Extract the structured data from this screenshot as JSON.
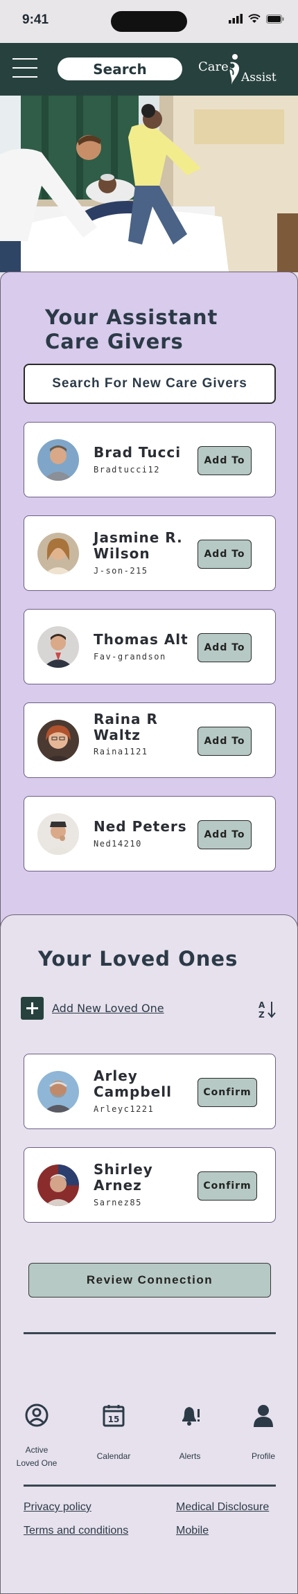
{
  "status_bar": {
    "time": "9:41"
  },
  "header": {
    "search_label": "Search",
    "logo_care": "Care",
    "logo_assist": "Assist"
  },
  "assistants": {
    "title_line1": "Your Assistant",
    "title_line2": "Care Givers",
    "search_new_label": "Search For New Care Givers",
    "cards": [
      {
        "name": "Brad Tucci",
        "username": "Bradtucci12",
        "button": "Add To"
      },
      {
        "name": "Jasmine R. Wilson",
        "username": "J-son-215",
        "button": "Add To"
      },
      {
        "name": "Thomas Alt",
        "username": "Fav-grandson",
        "button": "Add To"
      },
      {
        "name": "Raina R Waltz",
        "username": "Raina1121",
        "button": "Add To"
      },
      {
        "name": "Ned Peters",
        "username": "Ned14210",
        "button": "Add To"
      }
    ]
  },
  "loved_ones": {
    "title": "Your Loved Ones",
    "add_label": "Add New Loved One",
    "cards": [
      {
        "name": "Arley Campbell",
        "username": "Arleyc1221",
        "button": "Confirm"
      },
      {
        "name": "Shirley Arnez",
        "username": "Sarnez85",
        "button": "Confirm"
      }
    ],
    "review_label": "Review Connection"
  },
  "nav": {
    "active_line1": "Active",
    "active_line2": "Loved One",
    "calendar": "Calendar",
    "calendar_day": "15",
    "alerts": "Alerts",
    "profile": "Profile"
  },
  "footer": {
    "privacy": "Privacy policy",
    "medical": "Medical Disclosure",
    "terms": "Terms and conditions",
    "mobile": "Mobile"
  },
  "colors": {
    "header_bg": "#27423e",
    "panel_purple": "#d8cbeb",
    "panel_light": "#e6e1ec",
    "button_teal": "#b6c9c4"
  }
}
